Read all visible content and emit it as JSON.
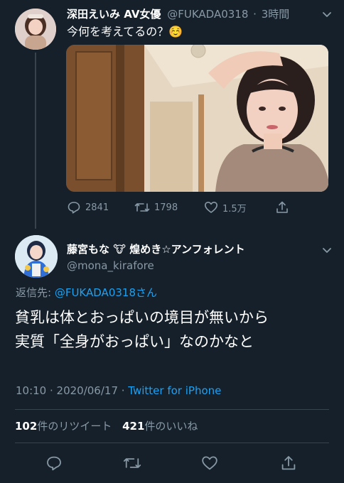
{
  "original_tweet": {
    "display_name": "深田えいみ AV女優",
    "handle": "@FUKADA0318",
    "time_ago": "3時間",
    "separator": "·",
    "text": "今何を考えてるの？☺️",
    "replies": "2841",
    "retweets": "1798",
    "likes": "1.5万"
  },
  "reply_tweet": {
    "display_name": "藤宮もな 🐮 煌めき☆アンフォレント",
    "handle": "@mona_kirafore",
    "reply_to_label": "返信先: ",
    "reply_to_mention": "@FUKADA0318さん",
    "body_line1": "貧乳は体とおっぱいの境目が無いから",
    "body_line2": "実質「全身がおっぱい」なのかなと",
    "timestamp": "10:10 · 2020/06/17 · ",
    "source": "Twitter for iPhone",
    "retweet_count": "102",
    "retweet_label": "件のリツイート",
    "like_count": "421",
    "like_label": "件のいいね"
  },
  "colors": {
    "background": "#15202b",
    "secondary_text": "#8899a6",
    "accent": "#1da1f2",
    "divider": "#38444d"
  }
}
